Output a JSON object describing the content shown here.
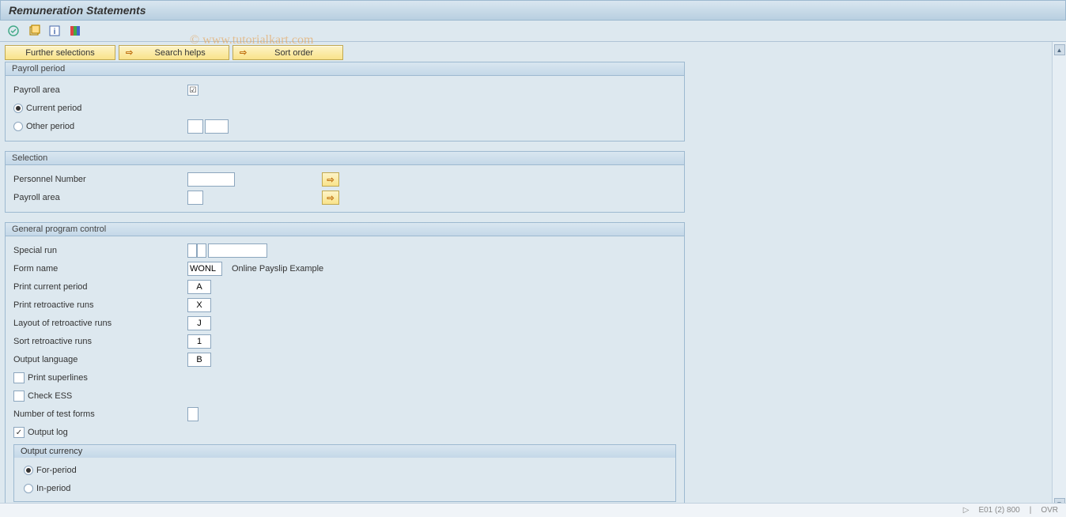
{
  "title": "Remuneration Statements",
  "watermark": "© www.tutorialkart.com",
  "actions": {
    "further_selections": "Further selections",
    "search_helps": "Search helps",
    "sort_order": "Sort order"
  },
  "payroll_period": {
    "title": "Payroll period",
    "payroll_area_label": "Payroll area",
    "current_period_label": "Current period",
    "other_period_label": "Other period"
  },
  "selection": {
    "title": "Selection",
    "personnel_number_label": "Personnel Number",
    "payroll_area_label": "Payroll area"
  },
  "general": {
    "title": "General program control",
    "special_run_label": "Special run",
    "form_name_label": "Form name",
    "form_name_value": "WONL",
    "form_name_desc": "Online Payslip Example",
    "print_current_label": "Print current period",
    "print_current_value": "A",
    "print_retro_label": "Print retroactive runs",
    "print_retro_value": "X",
    "layout_retro_label": "Layout of retroactive runs",
    "layout_retro_value": "J",
    "sort_retro_label": "Sort retroactive runs",
    "sort_retro_value": "1",
    "output_lang_label": "Output language",
    "output_lang_value": "B",
    "print_superlines_label": "Print superlines",
    "check_ess_label": "Check ESS",
    "num_test_forms_label": "Number of test forms",
    "output_log_label": "Output log"
  },
  "output_currency": {
    "title": "Output currency",
    "for_period_label": "For-period",
    "in_period_label": "In-period"
  },
  "status": {
    "system": "E01 (2) 800",
    "ovr": "OVR"
  }
}
